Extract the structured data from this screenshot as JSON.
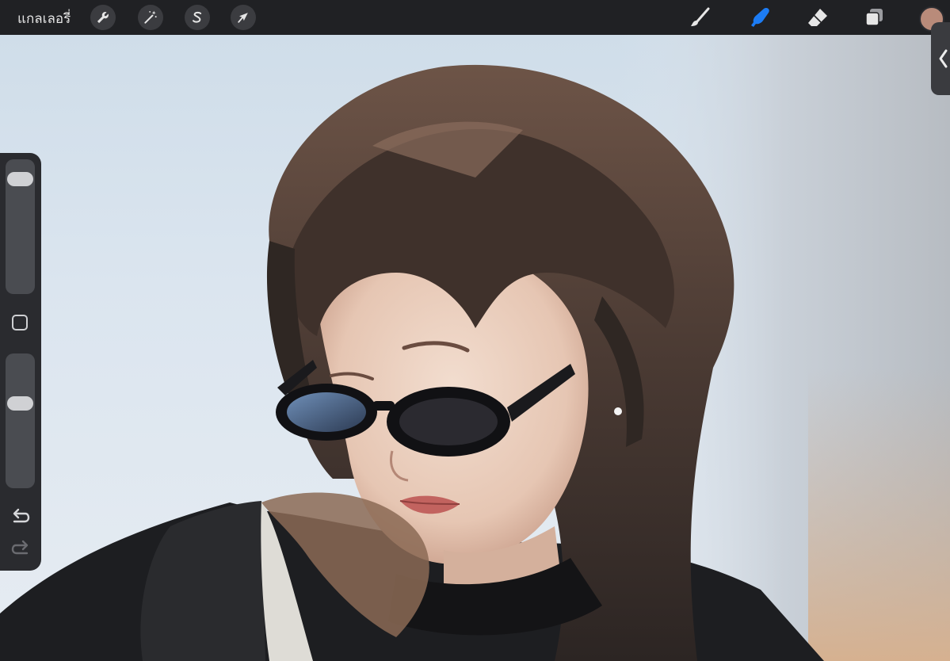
{
  "topbar": {
    "gallery_label": "แกลเลอรี่",
    "left_tools": [
      {
        "name": "actions",
        "icon": "wrench-icon"
      },
      {
        "name": "adjustments",
        "icon": "magic-wand-icon"
      },
      {
        "name": "selection",
        "icon": "selection-s-icon"
      },
      {
        "name": "transform",
        "icon": "arrow-cursor-icon"
      }
    ],
    "right_tools": [
      {
        "name": "brush",
        "icon": "brush-icon",
        "active": false
      },
      {
        "name": "smudge",
        "icon": "smudge-finger-icon",
        "active": true
      },
      {
        "name": "eraser",
        "icon": "eraser-icon",
        "active": false
      },
      {
        "name": "layers",
        "icon": "layers-icon",
        "active": false
      }
    ],
    "current_color": "#b98b7a"
  },
  "sidebar": {
    "brush_size_level": 0.92,
    "opacity_level": 0.65,
    "modifier_icon": "square-modifier-icon",
    "undo_icon": "undo-icon",
    "redo_icon": "redo-icon"
  },
  "right_tab": {
    "icon": "chevron-left-icon"
  },
  "colors": {
    "topbar_bg": "#202124",
    "accent_active": "#1c7cf4",
    "icon_color": "#e6e6e6"
  }
}
